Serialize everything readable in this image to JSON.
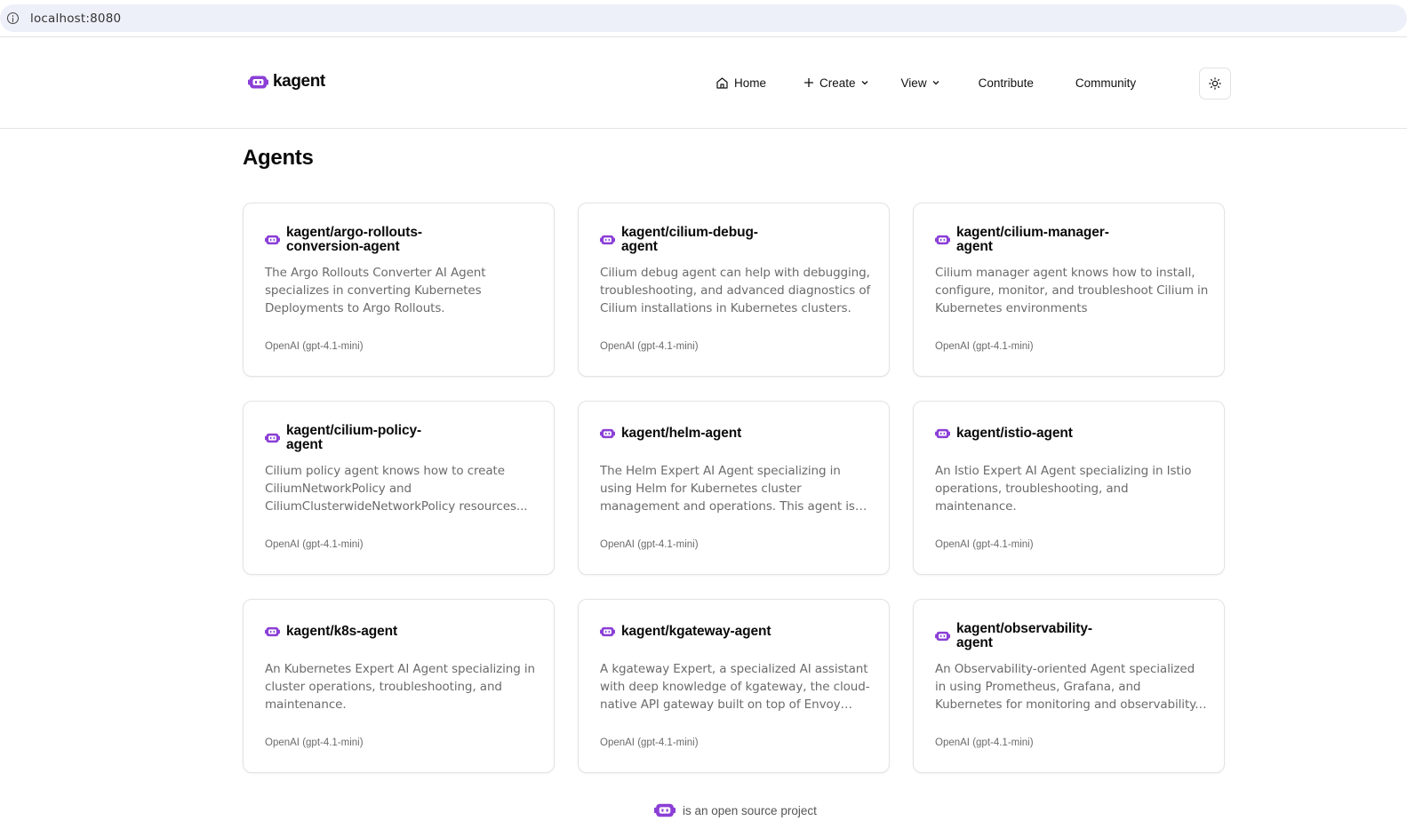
{
  "browser": {
    "url": "localhost:8080"
  },
  "header": {
    "logo_text": "kagent",
    "nav": {
      "home": "Home",
      "create": "Create",
      "view": "View",
      "contribute": "Contribute",
      "community": "Community"
    }
  },
  "page": {
    "title": "Agents"
  },
  "cards": [
    {
      "title_l1": "kagent/argo-rollouts-",
      "title_l2": "conversion-agent",
      "desc": "The Argo Rollouts Converter AI Agent specializes in converting Kubernetes Deployments to Argo Rollouts.",
      "model": "OpenAI (gpt-4.1-mini)"
    },
    {
      "title_l1": "kagent/cilium-debug-",
      "title_l2": "agent",
      "desc": "Cilium debug agent can help with debugging, troubleshooting, and advanced diagnostics of Cilium installations in Kubernetes clusters.",
      "model": "OpenAI (gpt-4.1-mini)"
    },
    {
      "title_l1": "kagent/cilium-manager-",
      "title_l2": "agent",
      "desc": "Cilium manager agent knows how to install, configure, monitor, and troubleshoot Cilium in Kubernetes environments",
      "model": "OpenAI (gpt-4.1-mini)"
    },
    {
      "title_l1": "kagent/cilium-policy-",
      "title_l2": "agent",
      "desc": "Cilium policy agent knows how to create CiliumNetworkPolicy and CiliumClusterwideNetworkPolicy resources...",
      "model": "OpenAI (gpt-4.1-mini)"
    },
    {
      "title_l1": "kagent/helm-agent",
      "title_l2": "",
      "desc": "The Helm Expert AI Agent specializing in using Helm for Kubernetes cluster management and operations. This agent is equipped with a rang...",
      "model": "OpenAI (gpt-4.1-mini)"
    },
    {
      "title_l1": "kagent/istio-agent",
      "title_l2": "",
      "desc": "An Istio Expert AI Agent specializing in Istio operations, troubleshooting, and maintenance.",
      "model": "OpenAI (gpt-4.1-mini)"
    },
    {
      "title_l1": "kagent/k8s-agent",
      "title_l2": "",
      "desc": "An Kubernetes Expert AI Agent specializing in cluster operations, troubleshooting, and maintenance.",
      "model": "OpenAI (gpt-4.1-mini)"
    },
    {
      "title_l1": "kagent/kgateway-agent",
      "title_l2": "",
      "desc": "A kgateway Expert, a specialized AI assistant with deep knowledge of kgateway, the cloud-native API gateway built on top of Envoy prox...",
      "model": "OpenAI (gpt-4.1-mini)"
    },
    {
      "title_l1": "kagent/observability-",
      "title_l2": "agent",
      "desc": "An Observability-oriented Agent specialized in using Prometheus, Grafana, and Kubernetes for monitoring and observability. This agent is...",
      "model": "OpenAI (gpt-4.1-mini)"
    }
  ],
  "footer": {
    "text": "is an open source project"
  },
  "colors": {
    "brand": "#8b3fd6"
  }
}
